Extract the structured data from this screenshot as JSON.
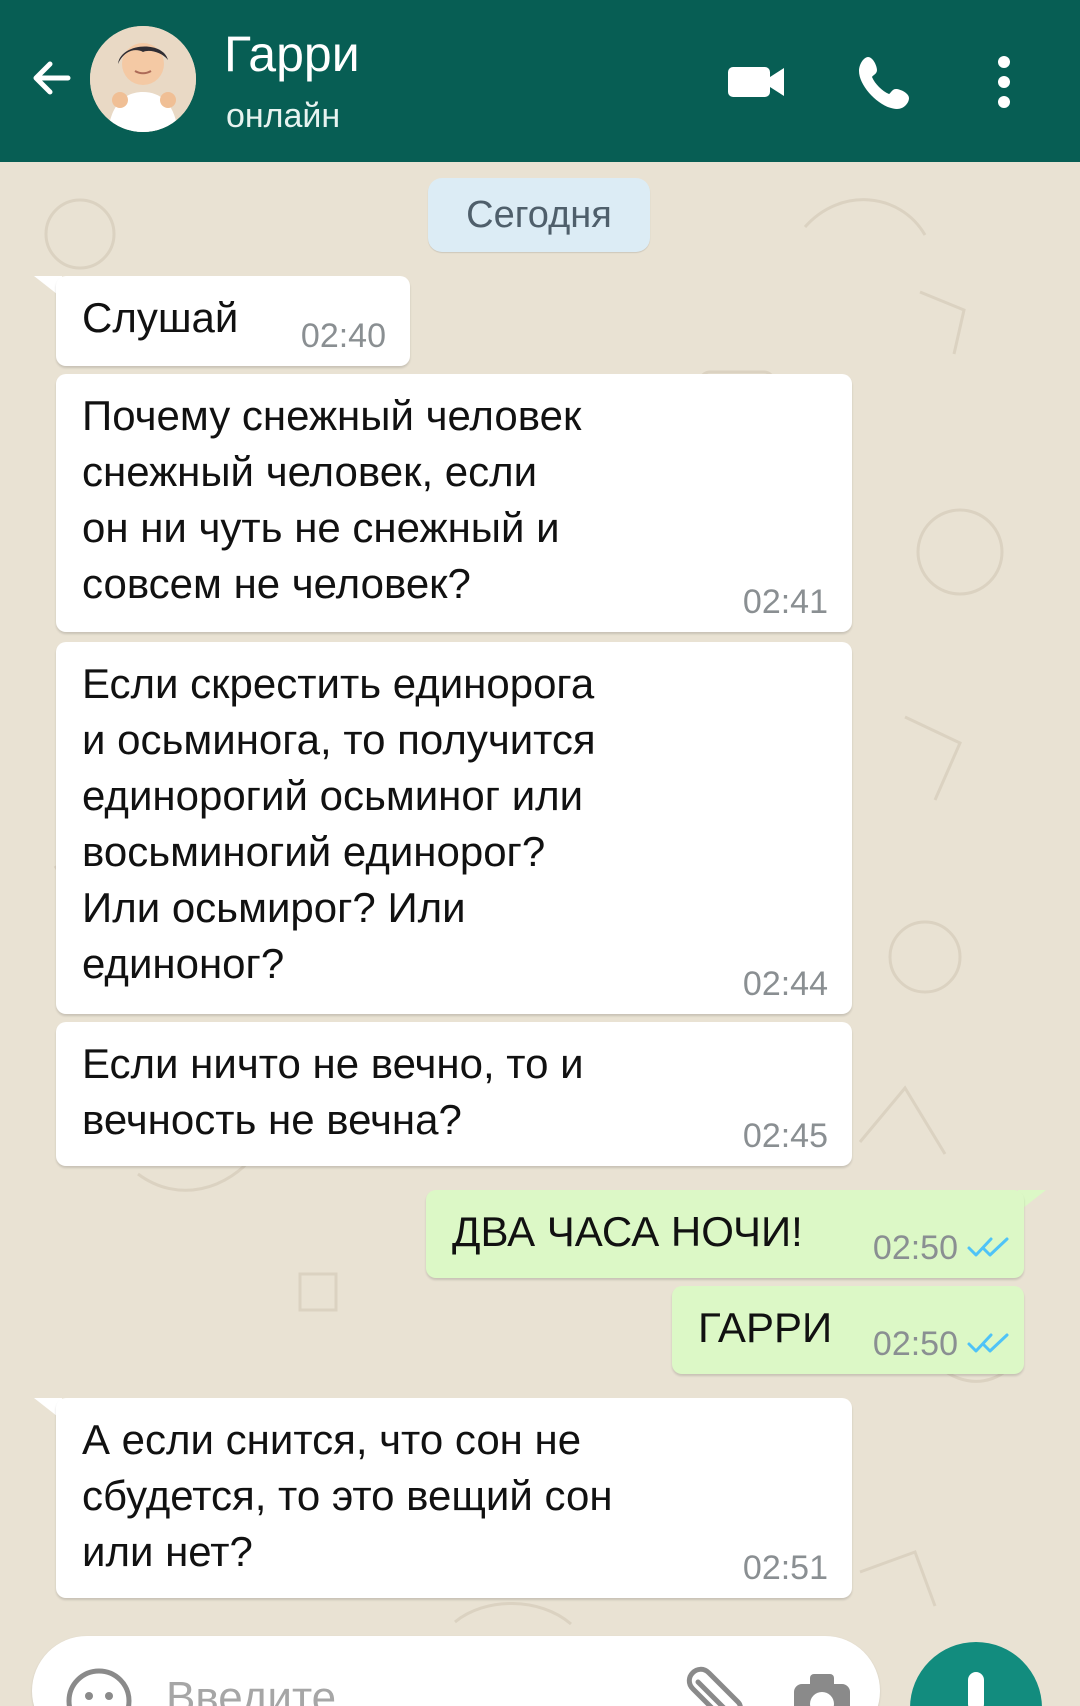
{
  "header": {
    "contact_name": "Гарри",
    "status": "онлайн",
    "icons": {
      "back": "back-arrow-icon",
      "video": "video-camera-icon",
      "call": "phone-icon",
      "menu": "more-vert-icon"
    }
  },
  "chat": {
    "date_chip": "Сегодня",
    "messages": [
      {
        "direction": "in",
        "text": "Слушай",
        "time": "02:40"
      },
      {
        "direction": "in",
        "text": "Почему снежный человек\nснежный человек, если\nон ни чуть не снежный и\nсовсем не человек?",
        "time": "02:41"
      },
      {
        "direction": "in",
        "text": "Если скрестить единорога\nи осьминога, то получится\nединорогий осьминог или\nвосьминогий единорог?\nИли осьмирог? Или\nединоног?",
        "time": "02:44"
      },
      {
        "direction": "in",
        "text": "Если ничто не вечно, то и\nвечность не вечна?",
        "time": "02:45"
      },
      {
        "direction": "out",
        "text": "ДВА ЧАСА НОЧИ!",
        "time": "02:50"
      },
      {
        "direction": "out",
        "text": "ГАРРИ",
        "time": "02:50"
      },
      {
        "direction": "in",
        "text": "А если снится, что сон не\nсбудется, то это вещий сон\nили нет?",
        "time": "02:51"
      }
    ]
  },
  "composer": {
    "placeholder": "Введите"
  },
  "colors": {
    "header": "#075e54",
    "incoming_bubble": "#ffffff",
    "outgoing_bubble": "#dcf8c6",
    "read_tick": "#4fc3f7",
    "wallpaper": "#e9e2d3"
  }
}
